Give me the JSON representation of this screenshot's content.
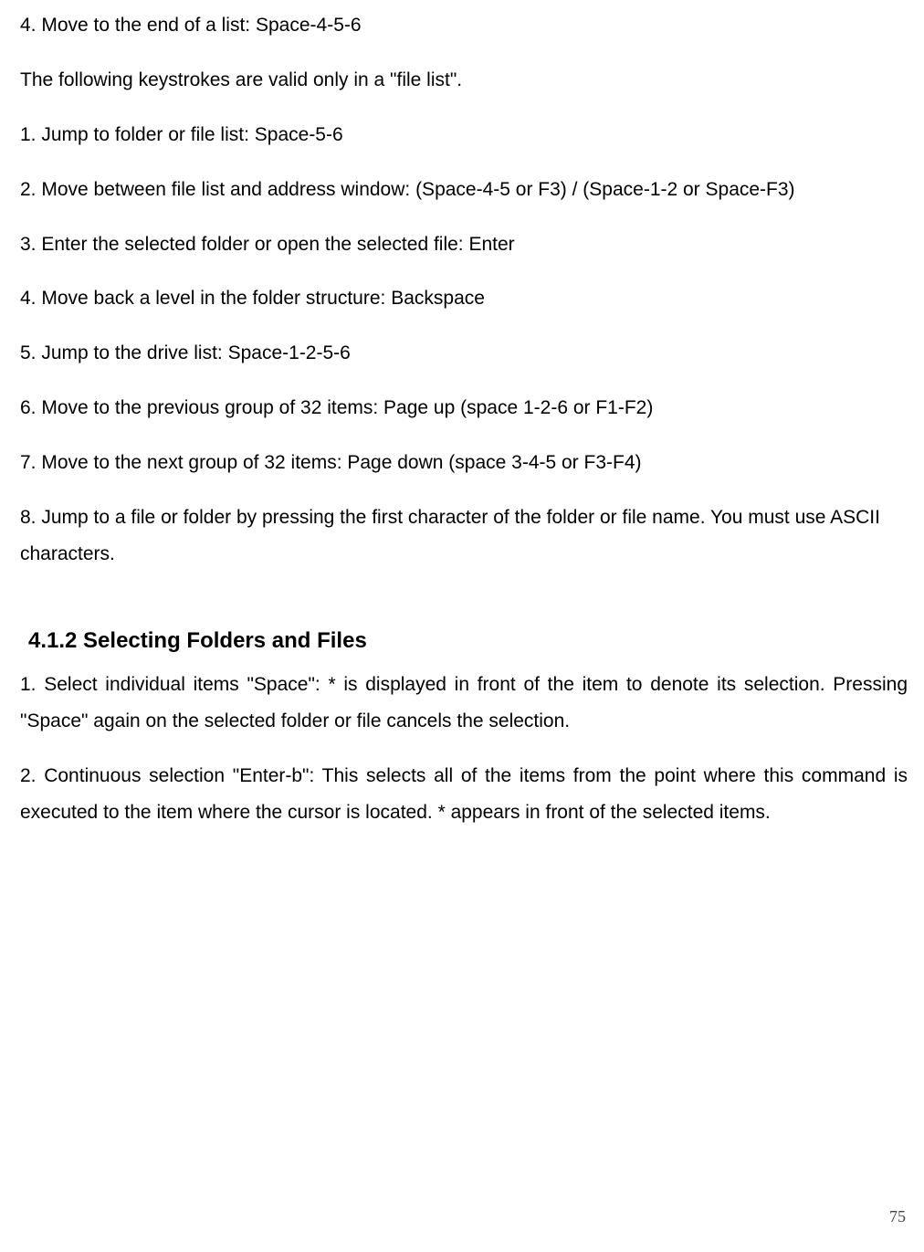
{
  "content": {
    "p1": "4. Move to the end of a list: Space-4-5-6",
    "p2": "The following keystrokes are valid only in a \"file list\".",
    "p3": "1. Jump to folder or file list: Space-5-6",
    "p4": "2. Move between file list and address window: (Space-4-5 or F3) / (Space-1-2 or Space-F3)",
    "p5": "3. Enter the selected folder or open the selected file: Enter",
    "p6": "4. Move back a level in the folder structure: Backspace",
    "p7": "5. Jump to the drive list: Space-1-2-5-6",
    "p8": "6. Move to the previous group of 32 items: Page up (space 1-2-6 or F1-F2)",
    "p9": "7. Move to the next group of 32 items: Page down (space 3-4-5 or F3-F4)",
    "p10": "8. Jump to a file or folder by pressing the first character of the folder or file name. You must use ASCII characters.",
    "heading": "4.1.2 Selecting Folders and Files",
    "p11": "1. Select individual items \"Space\": * is displayed in front of the item to denote its selection. Pressing \"Space\" again on the selected folder or file cancels the selection.",
    "p12": "2. Continuous selection \"Enter-b\": This selects all of the items from the point where this command is executed to the item where the cursor is located. * appears in front of the selected items.",
    "page_number": "75"
  }
}
